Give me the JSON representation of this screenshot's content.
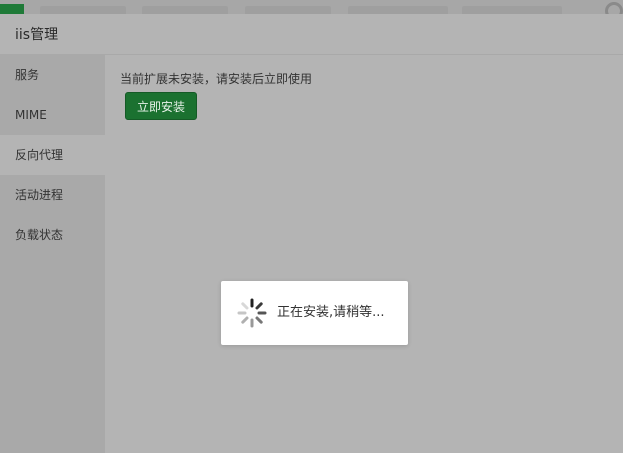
{
  "dialog": {
    "title": "iis管理"
  },
  "sidebar": {
    "items": [
      {
        "label": "服务"
      },
      {
        "label": "MIME"
      },
      {
        "label": "反向代理"
      },
      {
        "label": "活动进程"
      },
      {
        "label": "负载状态"
      }
    ],
    "active_index": 2
  },
  "content": {
    "notice": "当前扩展未安装，请安装后立即使用",
    "install_button": "立即安装"
  },
  "loading": {
    "text": "正在安装,请稍等..."
  },
  "colors": {
    "accent_green": "#1b7130",
    "overlay_gray": "#b4b4b4"
  }
}
